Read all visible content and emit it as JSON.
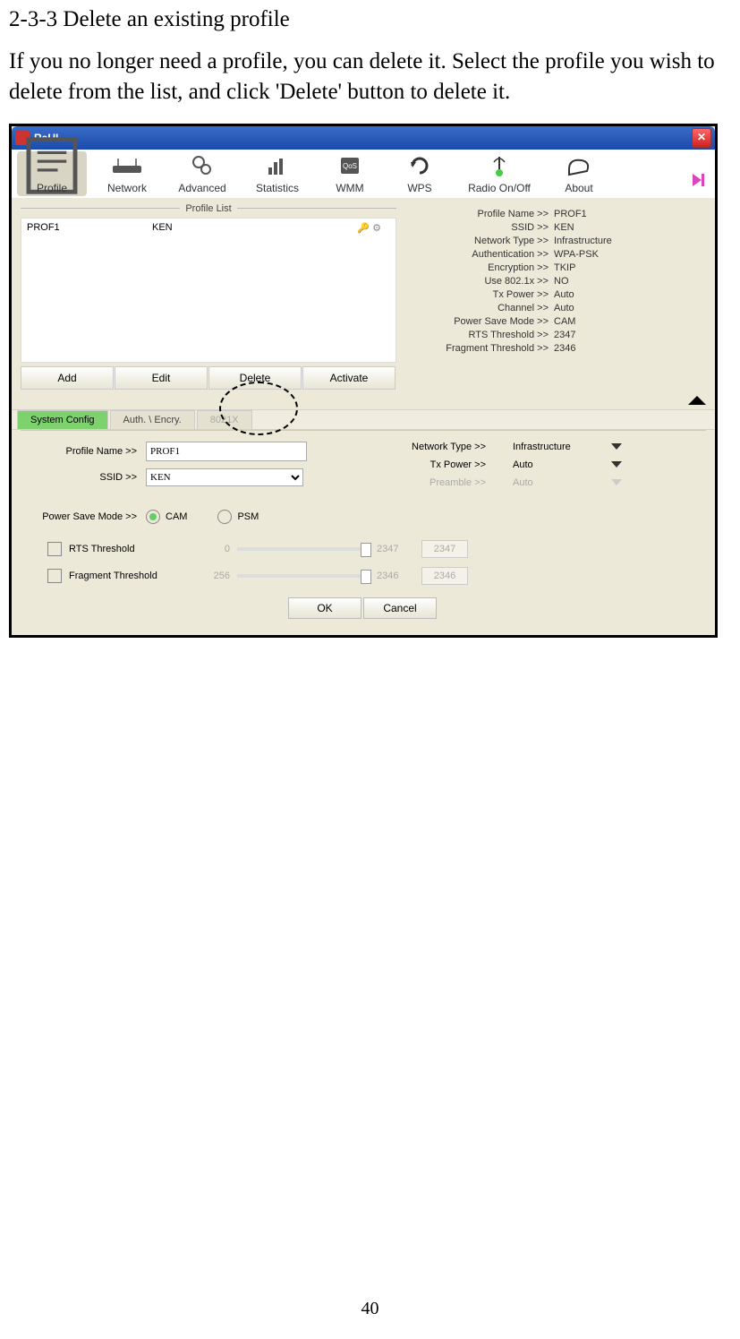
{
  "doc": {
    "heading": "2-3-3 Delete an existing profile",
    "body": "If you no longer need a profile, you can delete it. Select the profile you wish to delete from the list, and click 'Delete' button to delete it.",
    "page_num": "40"
  },
  "window": {
    "title": "RaUI",
    "tabs": [
      "Profile",
      "Network",
      "Advanced",
      "Statistics",
      "WMM",
      "WPS",
      "Radio On/Off",
      "About"
    ],
    "profile_list_label": "Profile List",
    "profile_row": {
      "name": "PROF1",
      "ssid": "KEN"
    },
    "buttons": {
      "add": "Add",
      "edit": "Edit",
      "delete": "Delete",
      "activate": "Activate"
    },
    "details": [
      {
        "label": "Profile Name >>",
        "value": "PROF1"
      },
      {
        "label": "SSID >>",
        "value": "KEN"
      },
      {
        "label": "Network Type >>",
        "value": "Infrastructure"
      },
      {
        "label": "Authentication >>",
        "value": "WPA-PSK"
      },
      {
        "label": "Encryption >>",
        "value": "TKIP"
      },
      {
        "label": "Use 802.1x >>",
        "value": "NO"
      },
      {
        "label": "Tx Power >>",
        "value": "Auto"
      },
      {
        "label": "Channel >>",
        "value": "Auto"
      },
      {
        "label": "Power Save Mode >>",
        "value": "CAM"
      },
      {
        "label": "RTS Threshold >>",
        "value": "2347"
      },
      {
        "label": "Fragment Threshold >>",
        "value": "2346"
      }
    ],
    "config_tabs": {
      "sys": "System Config",
      "auth": "Auth. \\ Encry.",
      "dot1x": "8021X"
    },
    "form": {
      "profile_name_label": "Profile Name >>",
      "profile_name": "PROF1",
      "ssid_label": "SSID >>",
      "ssid": "KEN",
      "psm_label": "Power Save Mode >>",
      "cam": "CAM",
      "psm": "PSM",
      "net_type_label": "Network Type >>",
      "net_type": "Infrastructure",
      "tx_label": "Tx Power >>",
      "tx": "Auto",
      "preamble_label": "Preamble >>",
      "preamble": "Auto",
      "rts_label": "RTS Threshold",
      "rts_min": "0",
      "rts_max": "2347",
      "rts_val": "2347",
      "frag_label": "Fragment Threshold",
      "frag_min": "256",
      "frag_max": "2346",
      "frag_val": "2346"
    },
    "ok": "OK",
    "cancel": "Cancel"
  }
}
